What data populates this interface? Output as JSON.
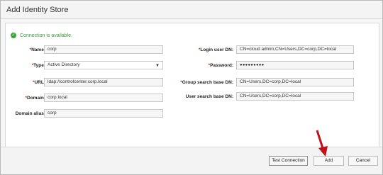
{
  "dialog": {
    "title": "Add Identity Store",
    "status": "Connection is available."
  },
  "left_fields": [
    {
      "label": "Name:",
      "required": true,
      "value": "corp"
    },
    {
      "label": "Type:",
      "required": true,
      "value": "Active Directory"
    },
    {
      "label": "URL:",
      "required": true,
      "value": "ldap://controlcenter.corp.local"
    },
    {
      "label": "Domain:",
      "required": true,
      "value": "corp.local"
    },
    {
      "label": "Domain alias:",
      "required": false,
      "value": "corp"
    }
  ],
  "right_fields": [
    {
      "label": "Login user DN:",
      "required": true,
      "value": "CN=cloud admin,CN=Users,DC=corp,DC=local"
    },
    {
      "label": "Password:",
      "required": true,
      "value": "●●●●●●●●●"
    },
    {
      "label": "Group search base DN:",
      "required": true,
      "value": "CN=Users,DC=corp,DC=local"
    },
    {
      "label": "User search base DN:",
      "required": false,
      "value": "CN=Users,DC=corp,DC=local"
    }
  ],
  "buttons": {
    "test_connection": "Test Connection",
    "add": "Add",
    "cancel": "Cancel"
  },
  "req_mark": "*",
  "colors": {
    "status_green": "#3a9a3a",
    "required_red": "#c0281c",
    "arrow_red": "#c1121b"
  }
}
